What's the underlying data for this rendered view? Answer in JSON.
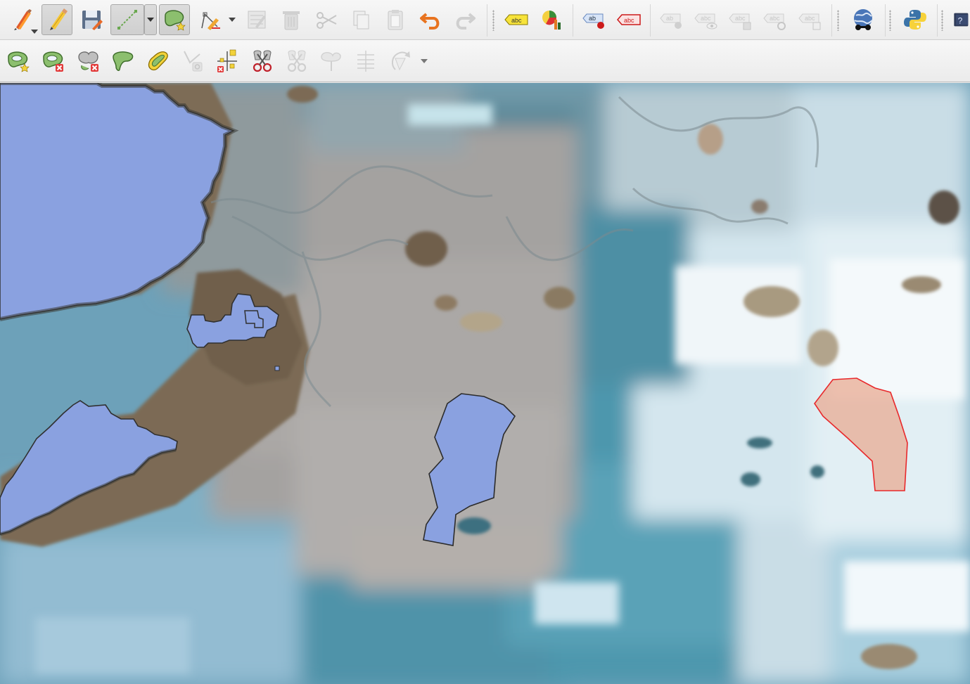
{
  "toolbar_digitizing": [
    {
      "name": "current-edits-icon",
      "state": "enabled"
    },
    {
      "name": "toggle-editing-icon",
      "state": "active"
    },
    {
      "name": "save-layer-edits-icon",
      "state": "enabled"
    },
    {
      "name": "digitize-with-segment-icon",
      "state": "active"
    },
    {
      "name": "add-polygon-feature-icon",
      "state": "active"
    },
    {
      "name": "vertex-tool-icon",
      "state": "enabled"
    },
    {
      "name": "modify-attributes-icon",
      "state": "disabled"
    },
    {
      "name": "delete-selected-icon",
      "state": "disabled"
    },
    {
      "name": "cut-features-icon",
      "state": "disabled"
    },
    {
      "name": "copy-features-icon",
      "state": "disabled"
    },
    {
      "name": "paste-features-icon",
      "state": "disabled"
    },
    {
      "name": "undo-icon",
      "state": "enabled"
    },
    {
      "name": "redo-icon",
      "state": "disabled"
    }
  ],
  "toolbar_labels": [
    {
      "name": "layer-labeling-options-icon",
      "text": "abc"
    },
    {
      "name": "layer-diagram-options-icon",
      "text": ""
    },
    {
      "name": "highlight-pinned-labels-icon",
      "text": "ab"
    },
    {
      "name": "toggle-display-unplaced-labels-icon",
      "text": "abc"
    },
    {
      "name": "pin-unpin-labels-icon",
      "text": "ab"
    },
    {
      "name": "show-hide-labels-icon",
      "text": "abc"
    },
    {
      "name": "move-label-icon",
      "text": "abc"
    },
    {
      "name": "rotate-label-icon",
      "text": "abc"
    },
    {
      "name": "change-label-properties-icon",
      "text": "abc"
    }
  ],
  "toolbar_plugins": [
    {
      "name": "metasearch-icon"
    },
    {
      "name": "python-console-icon"
    },
    {
      "name": "help-icon",
      "text": "?"
    }
  ],
  "toolbar_advanced_digitizing": [
    {
      "name": "add-ring-icon",
      "state": "enabled"
    },
    {
      "name": "delete-ring-icon",
      "state": "enabled"
    },
    {
      "name": "delete-part-icon",
      "state": "enabled"
    },
    {
      "name": "reshape-features-icon",
      "state": "enabled"
    },
    {
      "name": "offset-curve-icon",
      "state": "enabled"
    },
    {
      "name": "simplify-feature-icon",
      "state": "disabled"
    },
    {
      "name": "split-parts-icon",
      "state": "enabled"
    },
    {
      "name": "split-features-icon",
      "state": "enabled"
    },
    {
      "name": "merge-selected-features-icon",
      "state": "disabled"
    },
    {
      "name": "merge-attributes-icon",
      "state": "disabled"
    },
    {
      "name": "rotate-point-symbols-icon",
      "state": "disabled"
    },
    {
      "name": "rotate-feature-icon",
      "state": "disabled"
    }
  ],
  "map": {
    "layer_fill_color": "#8aa1e0",
    "selected_outline_color": "#e8282b",
    "selected_fill_color": "#e9a78f",
    "feature_outline_color": "#2b2b2b"
  },
  "colors": {
    "toolbar_bg": "#efefef",
    "active_bg": "#d4d4d4",
    "disabled_icon": "#c6c6c6"
  }
}
